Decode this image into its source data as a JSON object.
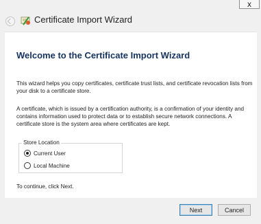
{
  "window": {
    "title": "Certificate Import Wizard",
    "close_glyph": "x"
  },
  "content": {
    "heading": "Welcome to the Certificate Import Wizard",
    "paragraph1": "This wizard helps you copy certificates, certificate trust lists, and certificate revocation lists from your disk to a certificate store.",
    "paragraph2": "A certificate, which is issued by a certification authority, is a confirmation of your identity and contains information used to protect data or to establish secure network connections. A certificate store is the system area where certificates are kept.",
    "store_location": {
      "legend": "Store Location",
      "options": [
        {
          "label": "Current User",
          "selected": true
        },
        {
          "label": "Local Machine",
          "selected": false
        }
      ]
    },
    "continue_text": "To continue, click Next."
  },
  "buttons": {
    "next": "Next",
    "cancel": "Cancel"
  },
  "icons": [
    "back-arrow-icon",
    "certificate-icon",
    "close-icon"
  ]
}
